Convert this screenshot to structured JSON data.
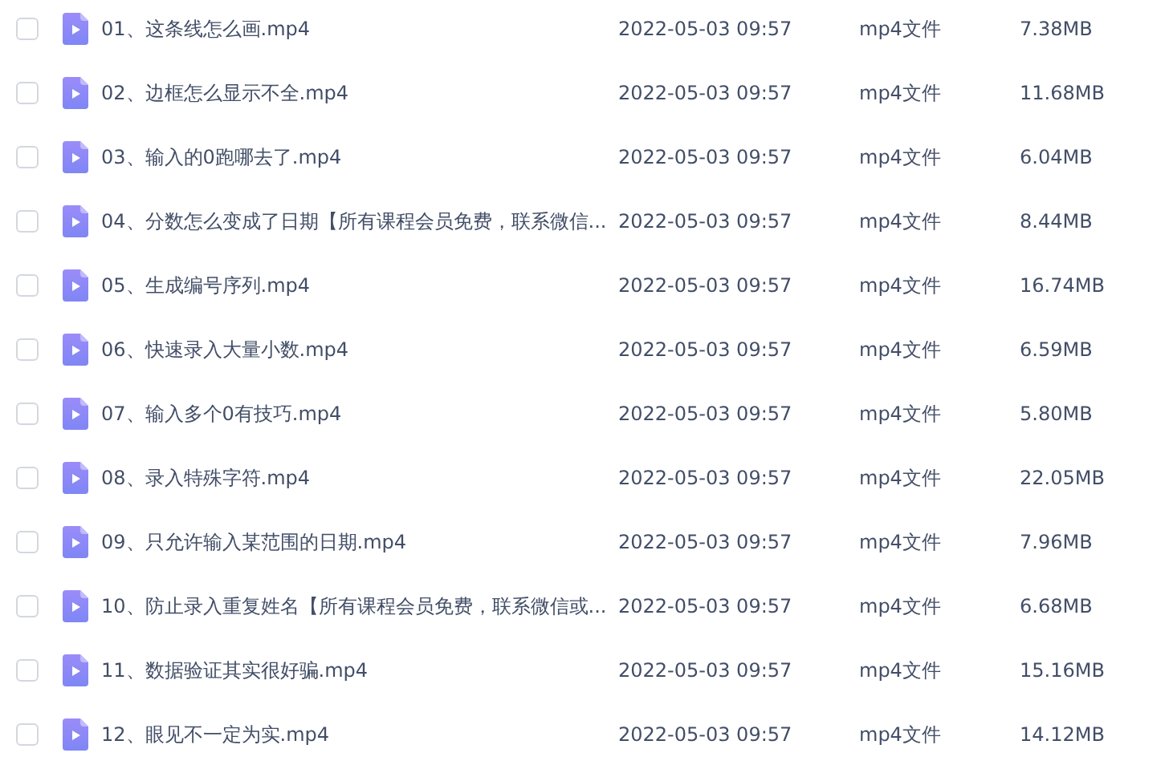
{
  "files": [
    {
      "checked": false,
      "name": "01、这条线怎么画.mp4",
      "modified": "2022-05-03 09:57",
      "type": "mp4文件",
      "size": "7.38MB"
    },
    {
      "checked": false,
      "name": "02、边框怎么显示不全.mp4",
      "modified": "2022-05-03 09:57",
      "type": "mp4文件",
      "size": "11.68MB"
    },
    {
      "checked": false,
      "name": "03、输入的0跑哪去了.mp4",
      "modified": "2022-05-03 09:57",
      "type": "mp4文件",
      "size": "6.04MB"
    },
    {
      "checked": false,
      "name": "04、分数怎么变成了日期【所有课程会员免费，联系微信...",
      "modified": "2022-05-03 09:57",
      "type": "mp4文件",
      "size": "8.44MB"
    },
    {
      "checked": false,
      "name": "05、生成编号序列.mp4",
      "modified": "2022-05-03 09:57",
      "type": "mp4文件",
      "size": "16.74MB"
    },
    {
      "checked": false,
      "name": "06、快速录入大量小数.mp4",
      "modified": "2022-05-03 09:57",
      "type": "mp4文件",
      "size": "6.59MB"
    },
    {
      "checked": false,
      "name": "07、输入多个0有技巧.mp4",
      "modified": "2022-05-03 09:57",
      "type": "mp4文件",
      "size": "5.80MB"
    },
    {
      "checked": false,
      "name": "08、录入特殊字符.mp4",
      "modified": "2022-05-03 09:57",
      "type": "mp4文件",
      "size": "22.05MB"
    },
    {
      "checked": false,
      "name": "09、只允许输入某范围的日期.mp4",
      "modified": "2022-05-03 09:57",
      "type": "mp4文件",
      "size": "7.96MB"
    },
    {
      "checked": false,
      "name": "10、防止录入重复姓名【所有课程会员免费，联系微信或...",
      "modified": "2022-05-03 09:57",
      "type": "mp4文件",
      "size": "6.68MB"
    },
    {
      "checked": false,
      "name": "11、数据验证其实很好骗.mp4",
      "modified": "2022-05-03 09:57",
      "type": "mp4文件",
      "size": "15.16MB"
    },
    {
      "checked": false,
      "name": "12、眼见不一定为实.mp4",
      "modified": "2022-05-03 09:57",
      "type": "mp4文件",
      "size": "14.12MB"
    }
  ]
}
